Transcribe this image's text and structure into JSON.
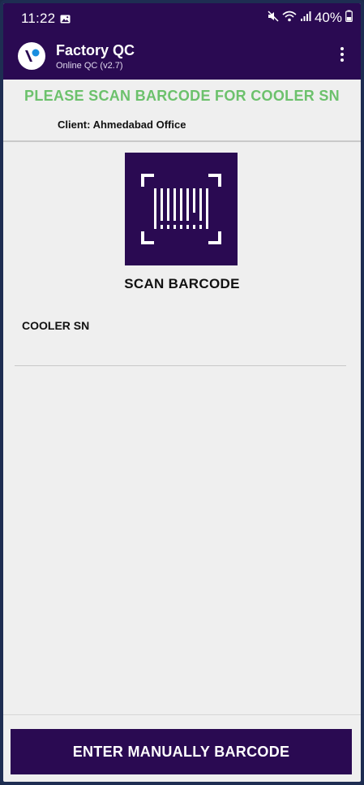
{
  "status_bar": {
    "time": "11:22",
    "battery": "40%",
    "icons": [
      "image-icon",
      "mute-icon",
      "wifi-icon",
      "signal-icon",
      "battery-icon"
    ]
  },
  "app_bar": {
    "title": "Factory QC",
    "subtitle": "Online QC (v2.7)",
    "logo_icon": "app-logo-icon",
    "menu_icon": "more-vert-icon"
  },
  "content": {
    "instruction": "PLEASE SCAN BARCODE FOR COOLER SN",
    "client": "Client: Ahmedabad Office",
    "scan_icon": "barcode-scan-icon",
    "scan_label": "SCAN BARCODE",
    "field_label": "COOLER SN",
    "field_value": ""
  },
  "footer": {
    "manual_button_label": "ENTER MANUALLY BARCODE"
  },
  "colors": {
    "primary": "#2a0a52",
    "instruction_green": "#6cc16c",
    "background": "#efefef"
  }
}
